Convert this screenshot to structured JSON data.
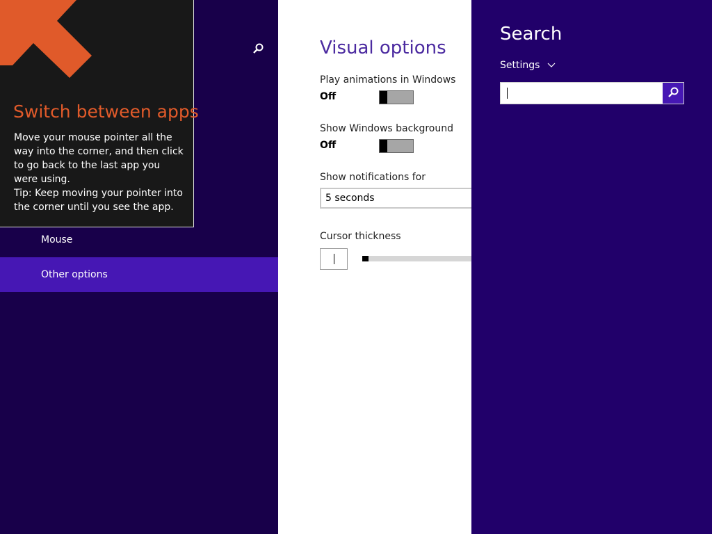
{
  "left_pane": {
    "nav_items": [
      "Mouse",
      "Other options"
    ]
  },
  "tip": {
    "title": "Switch between apps",
    "body_1": "Move your mouse pointer all the way into the corner, and then click to go back to the last app you were using.",
    "body_2": "Tip: Keep moving your pointer into the corner until you see the app."
  },
  "settings": {
    "title": "Visual options",
    "animations": {
      "label": "Play animations in Windows",
      "value": "Off"
    },
    "background": {
      "label": "Show Windows background",
      "value": "Off"
    },
    "notifications": {
      "label": "Show notifications for",
      "value": "5 seconds"
    },
    "cursor": {
      "label": "Cursor thickness",
      "level": 1
    }
  },
  "search": {
    "title": "Search",
    "scope": "Settings",
    "input_value": ""
  },
  "colors": {
    "background": "#18004a",
    "search_pane": "#21006a",
    "accent": "#4617b4",
    "tip_title": "#e05a2a",
    "settings_title": "#4b2aa0"
  }
}
